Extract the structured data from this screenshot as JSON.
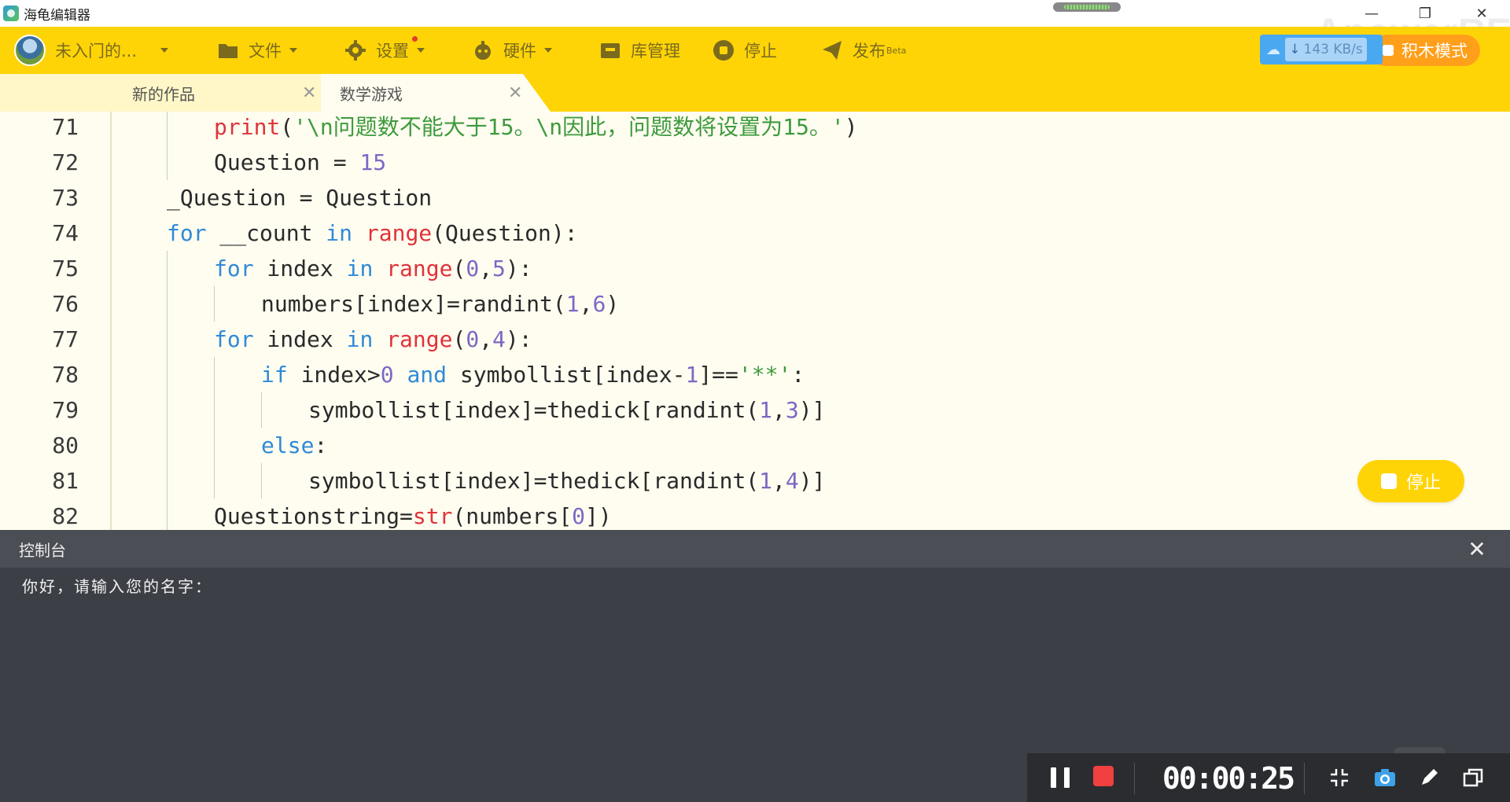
{
  "window": {
    "title": "海龟编辑器",
    "watermark": "ApowerREC"
  },
  "toolbar": {
    "user_label": "未入门的...",
    "file_label": "文件",
    "settings_label": "设置",
    "hardware_label": "硬件",
    "library_label": "库管理",
    "stop_label": "停止",
    "publish_label": "发布",
    "publish_badge": "Beta",
    "speed": "143 KB/s",
    "block_mode_label": "积木模式"
  },
  "tabs": [
    {
      "label": "新的作品",
      "active": false
    },
    {
      "label": "数学游戏",
      "active": true
    }
  ],
  "editor": {
    "lines": [
      {
        "n": "71",
        "indent": 2,
        "tokens": [
          [
            "fn",
            "print"
          ],
          [
            "p",
            "("
          ],
          [
            "str",
            "'\\n问题数不能大于15。\\n因此，问题数将设置为15。'"
          ],
          [
            "p",
            ")"
          ]
        ]
      },
      {
        "n": "72",
        "indent": 2,
        "tokens": [
          [
            "p",
            "Question = "
          ],
          [
            "num",
            "15"
          ]
        ]
      },
      {
        "n": "73",
        "indent": 1,
        "tokens": [
          [
            "p",
            "_Question = Question"
          ]
        ]
      },
      {
        "n": "74",
        "indent": 1,
        "tokens": [
          [
            "kw",
            "for"
          ],
          [
            "p",
            " __count "
          ],
          [
            "kw",
            "in"
          ],
          [
            "p",
            " "
          ],
          [
            "fn",
            "range"
          ],
          [
            "p",
            "(Question):"
          ]
        ]
      },
      {
        "n": "75",
        "indent": 2,
        "tokens": [
          [
            "kw",
            "for"
          ],
          [
            "p",
            " index "
          ],
          [
            "kw",
            "in"
          ],
          [
            "p",
            " "
          ],
          [
            "fn",
            "range"
          ],
          [
            "p",
            "("
          ],
          [
            "num",
            "0"
          ],
          [
            "p",
            ","
          ],
          [
            "num",
            "5"
          ],
          [
            "p",
            "):"
          ]
        ]
      },
      {
        "n": "76",
        "indent": 3,
        "tokens": [
          [
            "p",
            "numbers[index]=randint("
          ],
          [
            "num",
            "1"
          ],
          [
            "p",
            ","
          ],
          [
            "num",
            "6"
          ],
          [
            "p",
            ")"
          ]
        ]
      },
      {
        "n": "77",
        "indent": 2,
        "tokens": [
          [
            "kw",
            "for"
          ],
          [
            "p",
            " index "
          ],
          [
            "kw",
            "in"
          ],
          [
            "p",
            " "
          ],
          [
            "fn",
            "range"
          ],
          [
            "p",
            "("
          ],
          [
            "num",
            "0"
          ],
          [
            "p",
            ","
          ],
          [
            "num",
            "4"
          ],
          [
            "p",
            "):"
          ]
        ]
      },
      {
        "n": "78",
        "indent": 3,
        "tokens": [
          [
            "kw",
            "if"
          ],
          [
            "p",
            " index>"
          ],
          [
            "num",
            "0"
          ],
          [
            "p",
            " "
          ],
          [
            "kw",
            "and"
          ],
          [
            "p",
            " symbollist[index-"
          ],
          [
            "num",
            "1"
          ],
          [
            "p",
            "]=="
          ],
          [
            "str",
            "'**'"
          ],
          [
            "p",
            ":"
          ]
        ]
      },
      {
        "n": "79",
        "indent": 4,
        "tokens": [
          [
            "p",
            "symbollist[index]=thedick[randint("
          ],
          [
            "num",
            "1"
          ],
          [
            "p",
            ","
          ],
          [
            "num",
            "3"
          ],
          [
            "p",
            ")]"
          ]
        ]
      },
      {
        "n": "80",
        "indent": 3,
        "tokens": [
          [
            "kw",
            "else"
          ],
          [
            "p",
            ":"
          ]
        ]
      },
      {
        "n": "81",
        "indent": 4,
        "tokens": [
          [
            "p",
            "symbollist[index]=thedick[randint("
          ],
          [
            "num",
            "1"
          ],
          [
            "p",
            ","
          ],
          [
            "num",
            "4"
          ],
          [
            "p",
            ")]"
          ]
        ]
      },
      {
        "n": "82",
        "indent": 2,
        "tokens": [
          [
            "p",
            "Questionstring="
          ],
          [
            "fn",
            "str"
          ],
          [
            "p",
            "(numbers["
          ],
          [
            "num",
            "0"
          ],
          [
            "p",
            "])"
          ]
        ]
      }
    ],
    "float_stop_label": "停止"
  },
  "console": {
    "title": "控制台",
    "output": "你好，请输入您的名字："
  },
  "recorder": {
    "time": "00:00:25",
    "icons": [
      "pause-icon",
      "stop-record-icon",
      "collapse-icon",
      "camera-icon",
      "pen-icon",
      "window-icon"
    ]
  },
  "colors": {
    "toolbar": "#ffd407",
    "keyword": "#2f8ad8",
    "builtin": "#e0333a",
    "string": "#3d9a3d",
    "number": "#7c68c4",
    "console_bg": "#3c3f45"
  }
}
